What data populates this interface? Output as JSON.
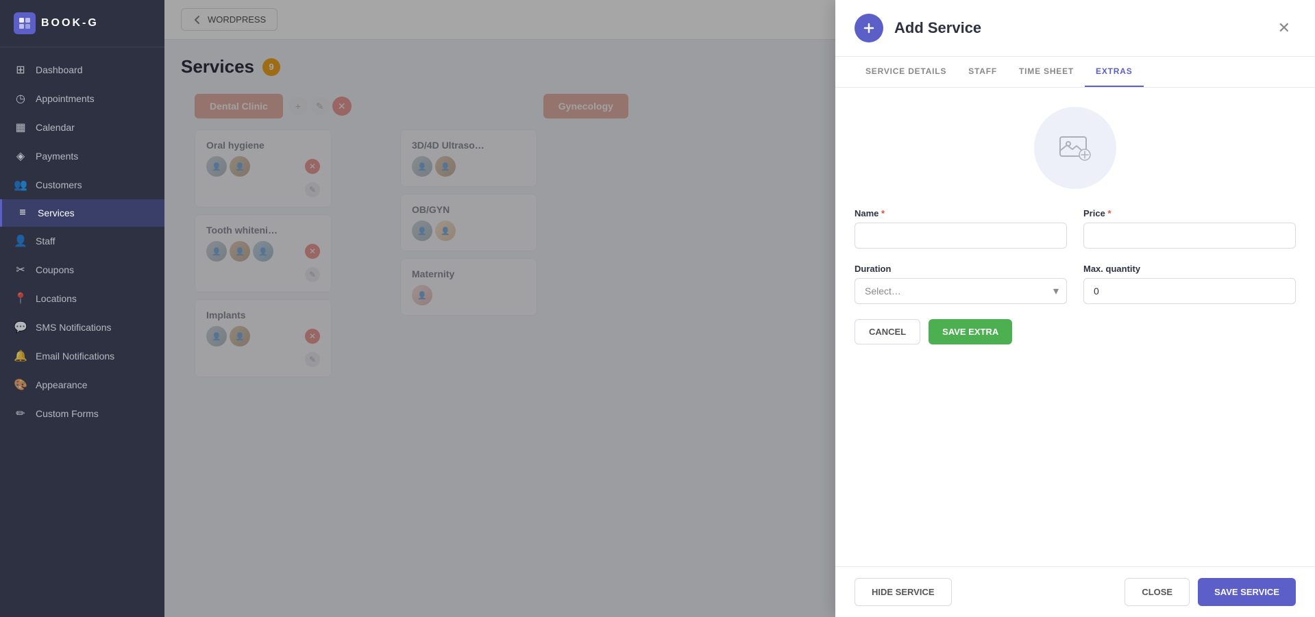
{
  "app": {
    "logo_text": "BOOK-G",
    "logo_letter": "B"
  },
  "sidebar": {
    "items": [
      {
        "id": "dashboard",
        "label": "Dashboard",
        "icon": "⊞",
        "active": false
      },
      {
        "id": "appointments",
        "label": "Appointments",
        "icon": "◷",
        "active": false
      },
      {
        "id": "calendar",
        "label": "Calendar",
        "icon": "📅",
        "active": false
      },
      {
        "id": "payments",
        "label": "Payments",
        "icon": "💳",
        "active": false
      },
      {
        "id": "customers",
        "label": "Customers",
        "icon": "👥",
        "active": false
      },
      {
        "id": "services",
        "label": "Services",
        "icon": "≡",
        "active": true
      },
      {
        "id": "staff",
        "label": "Staff",
        "icon": "👤",
        "active": false
      },
      {
        "id": "coupons",
        "label": "Coupons",
        "icon": "✂",
        "active": false
      },
      {
        "id": "locations",
        "label": "Locations",
        "icon": "📍",
        "active": false
      },
      {
        "id": "sms",
        "label": "SMS Notifications",
        "icon": "💬",
        "active": false
      },
      {
        "id": "email",
        "label": "Email Notifications",
        "icon": "🔔",
        "active": false
      },
      {
        "id": "appearance",
        "label": "Appearance",
        "icon": "🎨",
        "active": false
      },
      {
        "id": "custom-forms",
        "label": "Custom Forms",
        "icon": "✏",
        "active": false
      }
    ]
  },
  "topbar": {
    "wordpress_btn": "WORDPRESS"
  },
  "page": {
    "title": "Services",
    "badge_count": "9"
  },
  "categories": [
    {
      "name": "Dental Clinic",
      "services": [
        {
          "name": "Oral hygiene",
          "avatars": 2
        },
        {
          "name": "Tooth whiteni…",
          "avatars": 3
        },
        {
          "name": "Implants",
          "avatars": 2
        }
      ]
    },
    {
      "name": "Gynecology",
      "services": [
        {
          "name": "3D/4D Ultraso…",
          "avatars": 2
        },
        {
          "name": "OB/GYN",
          "avatars": 2
        },
        {
          "name": "Maternity",
          "avatars": 1
        }
      ]
    }
  ],
  "modal": {
    "title": "Add Service",
    "close_btn": "✕",
    "tabs": [
      {
        "id": "service-details",
        "label": "SERVICE DETAILS",
        "active": false
      },
      {
        "id": "staff",
        "label": "STAFF",
        "active": false
      },
      {
        "id": "time-sheet",
        "label": "TIME SHEET",
        "active": false
      },
      {
        "id": "extras",
        "label": "EXTRAS",
        "active": true
      }
    ],
    "form": {
      "name_label": "Name",
      "name_required": "*",
      "price_label": "Price",
      "price_required": "*",
      "duration_label": "Duration",
      "max_quantity_label": "Max. quantity",
      "duration_placeholder": "Select…",
      "max_quantity_value": "0"
    },
    "buttons": {
      "cancel": "CANCEL",
      "save_extra": "SAVE EXTRA",
      "hide_service": "HIDE SERVICE",
      "close": "CLOSE",
      "save_service": "SAVE SERVICE"
    }
  }
}
